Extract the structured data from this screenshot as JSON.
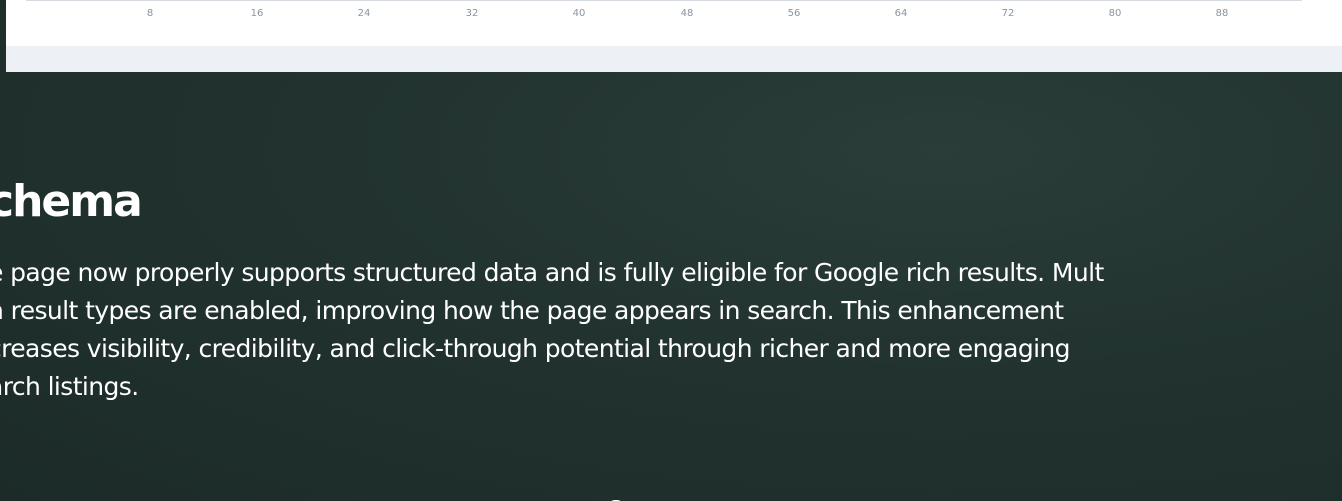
{
  "chart": {
    "x_ticks": [
      "8",
      "16",
      "24",
      "32",
      "40",
      "48",
      "56",
      "64",
      "72",
      "80",
      "88"
    ]
  },
  "schema_section": {
    "heading": "chema",
    "body_lines": [
      "e page now properly supports structured data and is fully eligible for Google rich results. Mult",
      "h result types are enabled, improving how the page appears in search. This enhancement",
      "creases visibility, credibility, and click-through potential through richer and more engaging",
      "arch listings."
    ]
  },
  "colors": {
    "background": "#22332f",
    "text": "#ffffff",
    "chart_panel": "#edf1f6",
    "tick_text": "#8a94a0"
  }
}
